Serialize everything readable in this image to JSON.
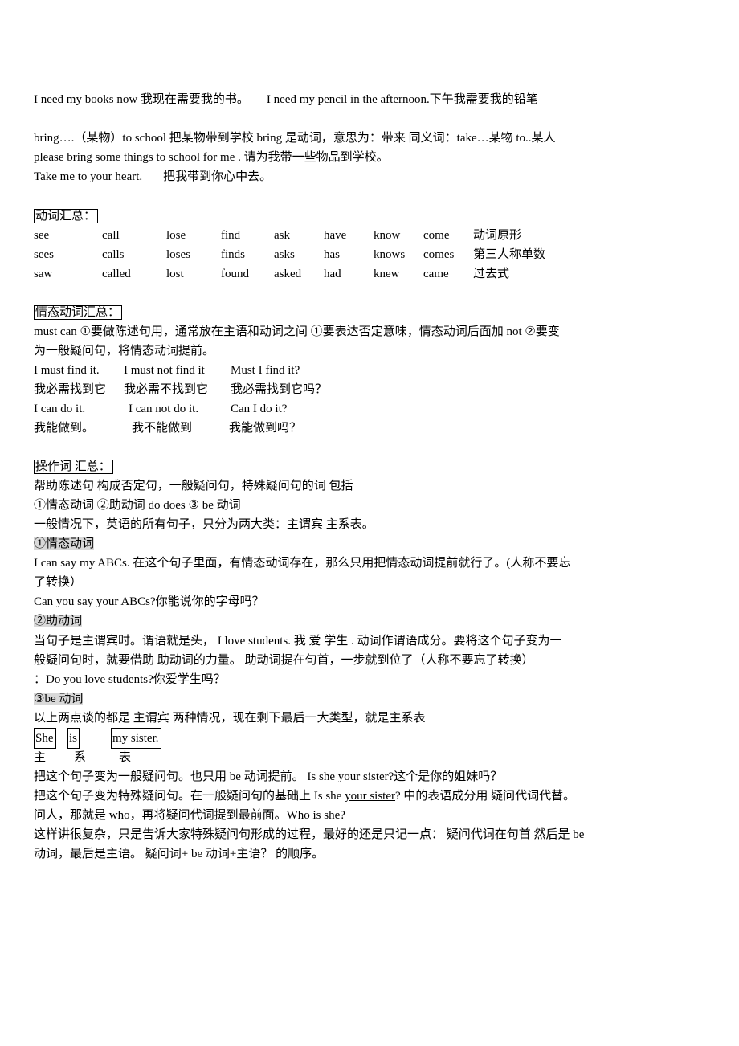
{
  "intro": {
    "line1a": "I need my books now  我现在需要我的书。",
    "line1b": "I need my pencil in the afternoon.下午我需要我的铅笔",
    "line2": "bring….（某物）to school  把某物带到学校  bring  是动词，意思为：带来    同义词：take…某物 to..某人",
    "line3": "please bring some things to school for me .    请为我带一些物品到学校。",
    "line4a": "Take me to your heart.",
    "line4b": "把我带到你心中去。"
  },
  "verbs": {
    "heading": "动词汇总：",
    "rows": [
      {
        "words": [
          "see",
          "call",
          "lose",
          "find",
          "ask",
          "have",
          "know",
          "come"
        ],
        "label": "动词原形"
      },
      {
        "words": [
          "sees",
          "calls",
          "loses",
          "finds",
          "asks",
          "has",
          "knows",
          "comes"
        ],
        "label": "第三人称单数"
      },
      {
        "words": [
          "saw",
          "called",
          "lost",
          "found",
          "asked",
          "had",
          "knew",
          "came"
        ],
        "label": "过去式"
      }
    ]
  },
  "modal": {
    "heading": "情态动词汇总：",
    "desc1": "must    can    ①要做陈述句用，通常放在主语和动词之间  ①要表达否定意味，情态动词后面加 not  ②要变",
    "desc2": "为一般疑问句，将情态动词提前。",
    "examples": [
      [
        "I must find it.",
        "I must not find it",
        "Must I find it?"
      ],
      [
        "我必需找到它",
        "我必需不找到它",
        "我必需找到它吗？"
      ],
      [
        "I can do it.",
        "I can not do it.",
        "Can I do it?"
      ],
      [
        "我能做到。",
        "我不能做到",
        "我能做到吗？"
      ]
    ]
  },
  "operator": {
    "heading": "操作词  汇总：",
    "p1": "帮助陈述句  构成否定句，一般疑问句，特殊疑问句的词    包括",
    "p2": "①情态动词      ②助动词  do    does    ③  be 动词",
    "p3": "一般情况下，英语的所有句子，只分为两大类：主谓宾    主系表。",
    "sub1": "①情态动词",
    "sub1_p1": "I can say my ABCs.    在这个句子里面，有情态动词存在，那么只用把情态动词提前就行了。(人称不要忘",
    "sub1_p2": "了转换）",
    "sub1_p3": "Can you say your ABCs?你能说你的字母吗？",
    "sub2": "②助动词",
    "sub2_p1": "当句子是主谓宾时。谓语就是头，  I love students. 我  爱  学生  . 动词作谓语成分。要将这个句子变为一",
    "sub2_p2": "般疑问句时，就要借助  助动词的力量。  助动词提在句首，一步就到位了（人称不要忘了转换）",
    "sub2_p3": "：Do you love students?你爱学生吗？",
    "sub3": "③be 动词",
    "sub3_p1": "  以上两点谈的都是    主谓宾  两种情况，现在剩下最后一大类型，就是主系表",
    "example_words": [
      "She",
      "is",
      "my sister."
    ],
    "example_roles": [
      "主",
      "系",
      "表"
    ],
    "p_q1": "把这个句子变为一般疑问句。也只用 be 动词提前。  Is she your sister?这个是你的姐妹吗？",
    "p_q2a": "把这个句子变为特殊疑问句。在一般疑问句的基础上  Is she ",
    "p_q2u": "your sister",
    "p_q2b": "?  中的表语成分用  疑问代词代替。",
    "p_q3": "问人，那就是 who，再将疑问代词提到最前面。Who is she?",
    "p_q4": "这样讲很复杂，只是告诉大家特殊疑问句形成的过程，最好的还是只记一点：  疑问代词在句首  然后是 be",
    "p_q5": "动词，最后是主语。      疑问词+ be 动词+主语？      的顺序。"
  }
}
